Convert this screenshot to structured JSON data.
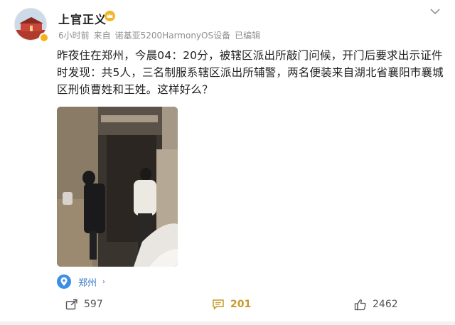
{
  "post": {
    "author": "上官正义",
    "time": "6小时前",
    "source_prefix": "来自",
    "device": "诺基亚5200HarmonyOS设备",
    "edited": "已编辑",
    "text": "昨夜住在郑州，今晨04：20分，被辖区派出所敲门问候，开门后要求出示证件时发现：共5人，三名制服系辖区派出所辅警，两名便装来自湖北省襄阳市襄城区刑侦曹姓和王姓。这样好么？",
    "location": "郑州",
    "location_arrow": "›"
  },
  "actions": {
    "repost_count": "597",
    "comment_count": "201",
    "like_count": "2462"
  },
  "icons": {
    "avatar": "avatar-image",
    "crown": "crown-icon",
    "more": "chevron-down-icon",
    "pin": "location-pin-icon",
    "repost": "repost-icon",
    "comment": "comment-icon",
    "like": "thumbs-up-icon"
  },
  "colors": {
    "accent_gold": "#c79a2a",
    "link_blue": "#3a7ac9",
    "meta_gray": "#8f8f8f"
  }
}
